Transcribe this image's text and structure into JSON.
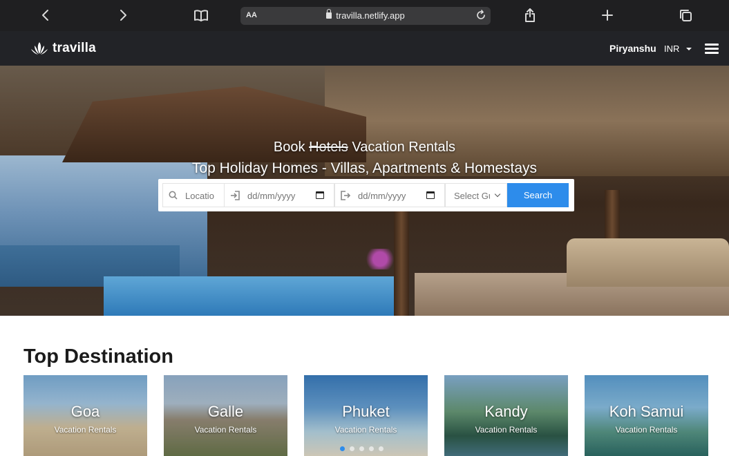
{
  "browser": {
    "text_size_label": "AA",
    "url": "travilla.netlify.app"
  },
  "nav": {
    "brand": "travilla",
    "user": "Piryanshu",
    "currency": "INR"
  },
  "hero": {
    "line1_prefix": "Book",
    "line1_struck": "Hotels",
    "line1_suffix": "Vacation Rentals",
    "line2": "Top Holiday Homes - Villas, Apartments & Homestays"
  },
  "search": {
    "location_placeholder": "Locatio",
    "checkin_placeholder": "dd/mm/yyyy",
    "checkout_placeholder": "dd/mm/yyyy",
    "guests_placeholder": "Select Gu",
    "button": "Search"
  },
  "destinations": {
    "title": "Top Destination",
    "items": [
      {
        "name": "Goa",
        "subtitle": "Vacation Rentals"
      },
      {
        "name": "Galle",
        "subtitle": "Vacation Rentals"
      },
      {
        "name": "Phuket",
        "subtitle": "Vacation Rentals"
      },
      {
        "name": "Kandy",
        "subtitle": "Vacation Rentals"
      },
      {
        "name": "Koh Samui",
        "subtitle": "Vacation Rentals"
      }
    ]
  },
  "colors": {
    "accent": "#2d8ceb",
    "nav_bg": "#222327",
    "browser_bg": "#1f1f21"
  }
}
